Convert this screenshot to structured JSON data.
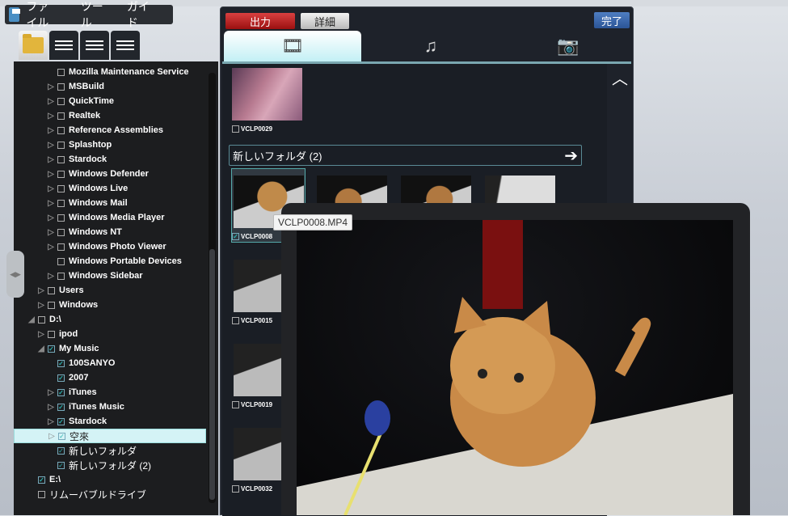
{
  "menu": {
    "items": [
      "ファイル",
      "ツール",
      "ガイド"
    ]
  },
  "view_tabs": [
    "folder-view",
    "checklist-view",
    "alphabetical-view",
    "numeric-view"
  ],
  "tree": [
    {
      "label": "Mozilla Maintenance Service",
      "level": 2,
      "arrow": false,
      "checked": false
    },
    {
      "label": "MSBuild",
      "level": 2,
      "arrow": true,
      "checked": false
    },
    {
      "label": "QuickTime",
      "level": 2,
      "arrow": true,
      "checked": false
    },
    {
      "label": "Realtek",
      "level": 2,
      "arrow": true,
      "checked": false
    },
    {
      "label": "Reference Assemblies",
      "level": 2,
      "arrow": true,
      "checked": false
    },
    {
      "label": "Splashtop",
      "level": 2,
      "arrow": true,
      "checked": false
    },
    {
      "label": "Stardock",
      "level": 2,
      "arrow": true,
      "checked": false
    },
    {
      "label": "Windows Defender",
      "level": 2,
      "arrow": true,
      "checked": false
    },
    {
      "label": "Windows Live",
      "level": 2,
      "arrow": true,
      "checked": false
    },
    {
      "label": "Windows Mail",
      "level": 2,
      "arrow": true,
      "checked": false
    },
    {
      "label": "Windows Media Player",
      "level": 2,
      "arrow": true,
      "checked": false
    },
    {
      "label": "Windows NT",
      "level": 2,
      "arrow": true,
      "checked": false
    },
    {
      "label": "Windows Photo Viewer",
      "level": 2,
      "arrow": true,
      "checked": false
    },
    {
      "label": "Windows Portable Devices",
      "level": 2,
      "arrow": false,
      "checked": false
    },
    {
      "label": "Windows Sidebar",
      "level": 2,
      "arrow": true,
      "checked": false
    },
    {
      "label": "Users",
      "level": 1,
      "arrow": true,
      "checked": false
    },
    {
      "label": "Windows",
      "level": 1,
      "arrow": true,
      "checked": false
    },
    {
      "label": "D:\\",
      "level": 0,
      "arrow": "open",
      "checked": false
    },
    {
      "label": "ipod",
      "level": 1,
      "arrow": true,
      "checked": false
    },
    {
      "label": "My Music",
      "level": 1,
      "arrow": "open",
      "checked": true
    },
    {
      "label": "100SANYO",
      "level": 2,
      "arrow": false,
      "checked": true
    },
    {
      "label": "2007",
      "level": 2,
      "arrow": false,
      "checked": true
    },
    {
      "label": "iTunes",
      "level": 2,
      "arrow": true,
      "checked": true
    },
    {
      "label": "iTunes Music",
      "level": 2,
      "arrow": true,
      "checked": true
    },
    {
      "label": "Stardock",
      "level": 2,
      "arrow": true,
      "checked": true
    },
    {
      "label": "空來",
      "level": 2,
      "arrow": true,
      "checked": true,
      "selected": true
    },
    {
      "label": "新しいフォルダ",
      "level": 2,
      "arrow": false,
      "checked": true
    },
    {
      "label": "新しいフォルダ (2)",
      "level": 2,
      "arrow": false,
      "checked": true
    },
    {
      "label": "E:\\",
      "level": 0,
      "arrow": false,
      "checked": true
    },
    {
      "label": "リムーバブルドライブ",
      "level": 0,
      "arrow": false,
      "checked": false
    }
  ],
  "toolbar": {
    "output": "出力",
    "details": "詳細",
    "done": "完了"
  },
  "media_tabs": [
    "video",
    "music",
    "photo"
  ],
  "clips": {
    "top": "VCLP0029",
    "folder": "新しいフォルダ (2)",
    "first": "VCLP0008",
    "col": [
      "VCLP0015",
      "VCLP0019",
      "VCLP0032"
    ]
  },
  "tooltip": "VCLP0008.MP4"
}
